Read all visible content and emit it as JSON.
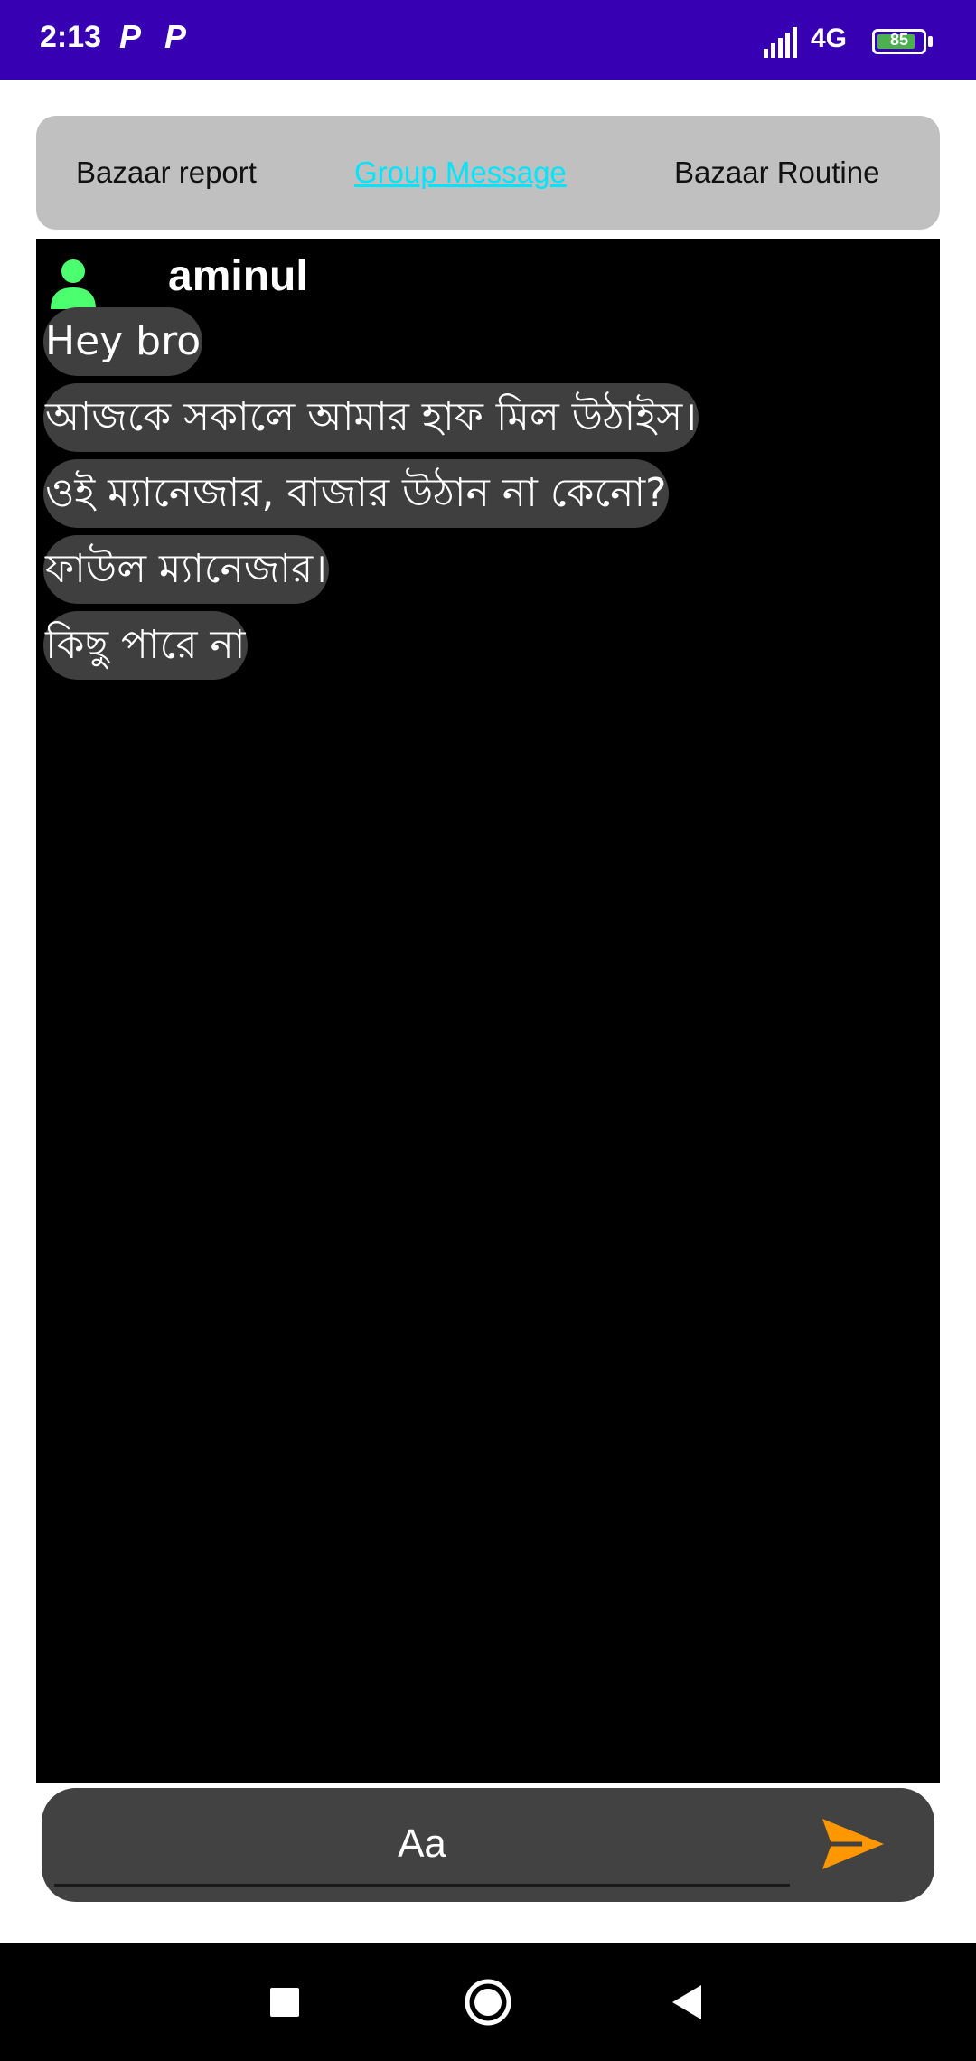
{
  "status_bar": {
    "time": "2:13",
    "notification_icons": [
      "P",
      "P"
    ],
    "network": "4G",
    "battery_level": "85",
    "battery_fraction": 0.85
  },
  "tabs": [
    {
      "label": "Bazaar report",
      "active": false
    },
    {
      "label": "Group Message",
      "active": true
    },
    {
      "label": "Bazaar Routine",
      "active": false
    }
  ],
  "chat": {
    "sender": "aminul",
    "avatar_icon": "person-icon",
    "avatar_color": "#4cff6e",
    "messages": [
      "Hey bro",
      "আজকে সকালে আমার হাফ মিল উঠাইস।",
      "ওই ম্যানেজার, বাজার উঠান না কেনো?",
      "ফাউল ম্যানেজার।",
      "কিছু পারে না"
    ]
  },
  "composer": {
    "placeholder": "Aa",
    "send_icon": "send-icon",
    "send_color": "#ff9800"
  },
  "nav": {
    "recents_icon": "square-icon",
    "home_icon": "circle-icon",
    "back_icon": "triangle-back-icon"
  },
  "colors": {
    "status_bar": "#3700b3",
    "active_tab": "#00e5ff",
    "bubble": "#3f3f3f"
  }
}
